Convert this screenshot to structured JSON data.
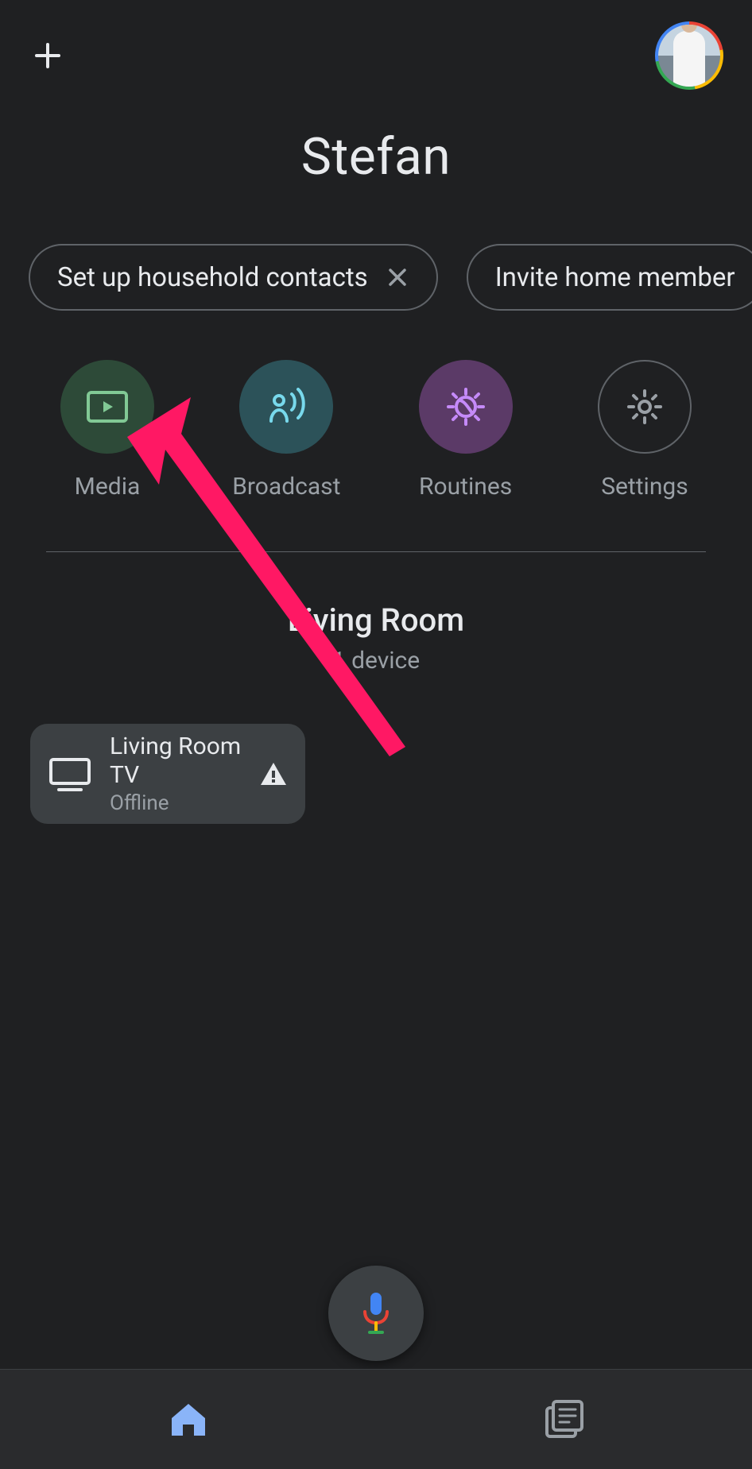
{
  "header": {
    "title": "Stefan"
  },
  "pills": [
    {
      "label": "Set up household contacts",
      "closable": true
    },
    {
      "label": "Invite home member",
      "closable": false
    }
  ],
  "actions": [
    {
      "label": "Media",
      "icon": "media-icon",
      "color": "media"
    },
    {
      "label": "Broadcast",
      "icon": "broadcast-icon",
      "color": "broadcast"
    },
    {
      "label": "Routines",
      "icon": "routines-icon",
      "color": "routines"
    },
    {
      "label": "Settings",
      "icon": "settings-icon",
      "color": "settings"
    }
  ],
  "room": {
    "name": "Living Room",
    "subtitle": "1 device",
    "devices": [
      {
        "name": "Living Room TV",
        "status": "Offline",
        "warning": true
      }
    ]
  },
  "nav": {
    "home_active": true
  }
}
